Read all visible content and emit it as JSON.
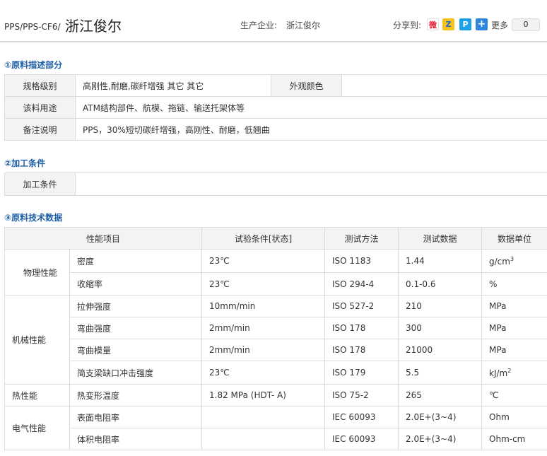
{
  "header": {
    "grade": "PPS/PPS-CF6/",
    "maker_big": "浙江俊尔",
    "maker_label": "生产企业:",
    "maker_name": "浙江俊尔",
    "share_label": "分享到:",
    "share_icons": [
      "weibo-icon",
      "qzone-icon",
      "tencent-weibo-icon",
      "more-plus-icon"
    ],
    "more_label": "更多",
    "share_count": "0"
  },
  "section1": {
    "title": "①原料描述部分",
    "spec_label": "规格级别",
    "spec_value": "高刚性,耐磨,碳纤增强 其它 其它",
    "color_label": "外观颜色",
    "color_value": "",
    "usage_label": "该料用途",
    "usage_value": "ATM结构部件、航模、拖链、输送托架体等",
    "note_label": "备注说明",
    "note_value": "PPS，30%短切碳纤增强，高刚性、耐磨，低翘曲"
  },
  "section2": {
    "title": "②加工条件",
    "proc_label": "加工条件",
    "proc_value": ""
  },
  "section3": {
    "title": "③原料技术数据",
    "headers": [
      "性能项目",
      "试验条件[状态]",
      "测试方法",
      "测试数据",
      "数据单位"
    ],
    "groups": [
      {
        "category": "物理性能",
        "rows": [
          {
            "item": "密度",
            "cond": "23℃",
            "method": "ISO 1183",
            "value": "1.44",
            "unit": "g/cm",
            "unit_sup": "3"
          },
          {
            "item": "收缩率",
            "cond": "23℃",
            "method": "ISO 294-4",
            "value": "0.1-0.6",
            "unit": "%"
          }
        ]
      },
      {
        "category": "机械性能",
        "rows": [
          {
            "item": "拉伸强度",
            "cond": "10mm/min",
            "method": "ISO 527-2",
            "value": "210",
            "unit": "MPa"
          },
          {
            "item": "弯曲强度",
            "cond": "2mm/min",
            "method": "ISO 178",
            "value": "300",
            "unit": "MPa"
          },
          {
            "item": "弯曲模量",
            "cond": "2mm/min",
            "method": "ISO 178",
            "value": "21000",
            "unit": "MPa"
          },
          {
            "item": "简支梁缺口冲击强度",
            "cond": "23℃",
            "method": "ISO 179",
            "value": "5.5",
            "unit": "kJ/m",
            "unit_sup": "2"
          }
        ]
      },
      {
        "category": "热性能",
        "rows": [
          {
            "item": "热变形温度",
            "cond": "1.82 MPa (HDT- A)",
            "method": "ISO 75-2",
            "value": "265",
            "unit": "℃"
          }
        ]
      },
      {
        "category": "电气性能",
        "rows": [
          {
            "item": "表面电阻率",
            "cond": "",
            "method": "IEC 60093",
            "value": "2.0E+(3~4)",
            "unit": "Ohm"
          },
          {
            "item": "体积电阻率",
            "cond": "",
            "method": "IEC 60093",
            "value": "2.0E+(3~4)",
            "unit": "Ohm-cm"
          }
        ]
      }
    ]
  }
}
